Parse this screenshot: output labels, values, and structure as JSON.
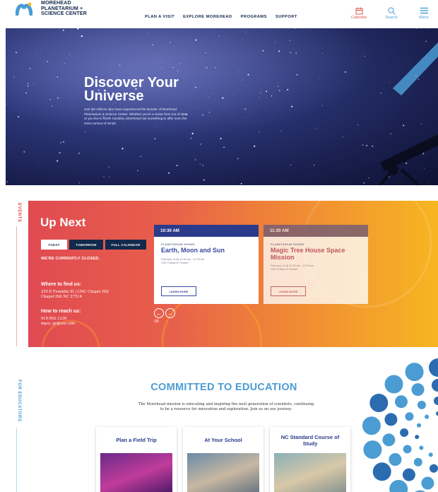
{
  "header": {
    "logo_lines": [
      "MOREHEAD",
      "PLANETARIUM +",
      "SCIENCE CENTER"
    ],
    "nav": [
      "PLAN A VISIT",
      "EXPLORE MOREHEAD",
      "PROGRAMS",
      "SUPPORT"
    ],
    "tools": [
      {
        "label": "Calendar",
        "icon": "calendar-icon"
      },
      {
        "label": "Search",
        "icon": "search-icon"
      },
      {
        "label": "Menu",
        "icon": "hamburger-icon"
      }
    ]
  },
  "hero": {
    "title": "Discover Your Universe",
    "text": "Join the millions who have experienced the wonder of Morehead Planetarium & Science Center. Whether you're a visitor from out of state or you live in North Carolina, Morehead has something to offer even the most curious of minds."
  },
  "events": {
    "side_label": "EVENTS",
    "title": "Up Next",
    "buttons": {
      "today": "TODAY",
      "tomorrow": "TOMORROW",
      "full": "FULL CALENDAR"
    },
    "closed": "WE'RE CURRENTLY CLOSED.",
    "where_heading": "Where to find us:",
    "address_1": "250 E Franklin St | UNC Chapel Hill",
    "address_2": "Chapel Hill NC 27514",
    "how_heading": "How to reach us:",
    "phone": "919.962.1236",
    "email": "mpsc_gr@unc.edu",
    "cards": [
      {
        "time": "10:30 AM",
        "category": "PLANETARIUM SHOWS",
        "title": "Earth, Moon and Sun",
        "date": "February 14 @ 10:30 am - 11:30 am",
        "location": "GSK Fulldome Theater",
        "button": "LEARN MORE"
      },
      {
        "time": "11:30 AM",
        "category": "PLANETARIUM SHOWS",
        "title": "Magic Tree House Space Mission",
        "date": "February 14 @ 11:30 am - 12:30 pm",
        "location": "GSK Fulldome Theater",
        "button": "LEARN MORE"
      }
    ],
    "pager": "1/5"
  },
  "education": {
    "side_label": "FOR EDUCATORS",
    "title": "COMMITTED TO EDUCATION",
    "text": "The Morehead mission is educating and inspiring the next generation of scientists, continuing to be a resource for innovation and exploration. Join us on our journey.",
    "cards": [
      "Plan a Field Trip",
      "At Your School",
      "NC Standard Course of Study"
    ]
  },
  "colors": {
    "navy": "#13294b",
    "carolina_blue": "#4b9cd3",
    "coral": "#e2504a",
    "gold": "#f7b621"
  }
}
